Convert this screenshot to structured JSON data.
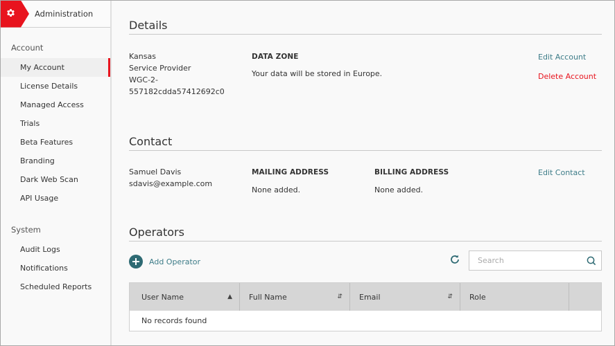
{
  "sidebar": {
    "header_title": "Administration",
    "brand_icon": "gear-icon",
    "groups": [
      {
        "label": "Account",
        "items": [
          {
            "label": "My Account",
            "active": true
          },
          {
            "label": "License Details"
          },
          {
            "label": "Managed Access"
          },
          {
            "label": "Trials"
          },
          {
            "label": "Beta Features"
          },
          {
            "label": "Branding"
          },
          {
            "label": "Dark Web Scan"
          },
          {
            "label": "API Usage"
          }
        ]
      },
      {
        "label": "System",
        "items": [
          {
            "label": "Audit Logs"
          },
          {
            "label": "Notifications"
          },
          {
            "label": "Scheduled Reports"
          }
        ]
      }
    ]
  },
  "details": {
    "title": "Details",
    "lines": [
      "Kansas",
      "Service Provider",
      "WGC-2-",
      "557182cdda57412692c0"
    ],
    "data_zone_label": "DATA ZONE",
    "data_zone_text": "Your data will be stored in Europe.",
    "edit_label": "Edit Account",
    "delete_label": "Delete Account"
  },
  "contact": {
    "title": "Contact",
    "name": "Samuel Davis",
    "email": "sdavis@example.com",
    "mailing_label": "MAILING ADDRESS",
    "mailing_value": "None added.",
    "billing_label": "BILLING ADDRESS",
    "billing_value": "None added.",
    "edit_label": "Edit Contact"
  },
  "operators": {
    "title": "Operators",
    "add_label": "Add Operator",
    "search_placeholder": "Search",
    "search_value": "",
    "columns": [
      {
        "label": "User Name",
        "sort": "asc"
      },
      {
        "label": "Full Name",
        "sort": "both"
      },
      {
        "label": "Email",
        "sort": "both"
      },
      {
        "label": "Role",
        "sort": "none"
      },
      {
        "label": "",
        "sort": "none"
      }
    ],
    "empty_text": "No records found"
  },
  "colors": {
    "accent_red": "#e8141e",
    "link_teal": "#3d7c88",
    "button_teal": "#2e6a73"
  }
}
